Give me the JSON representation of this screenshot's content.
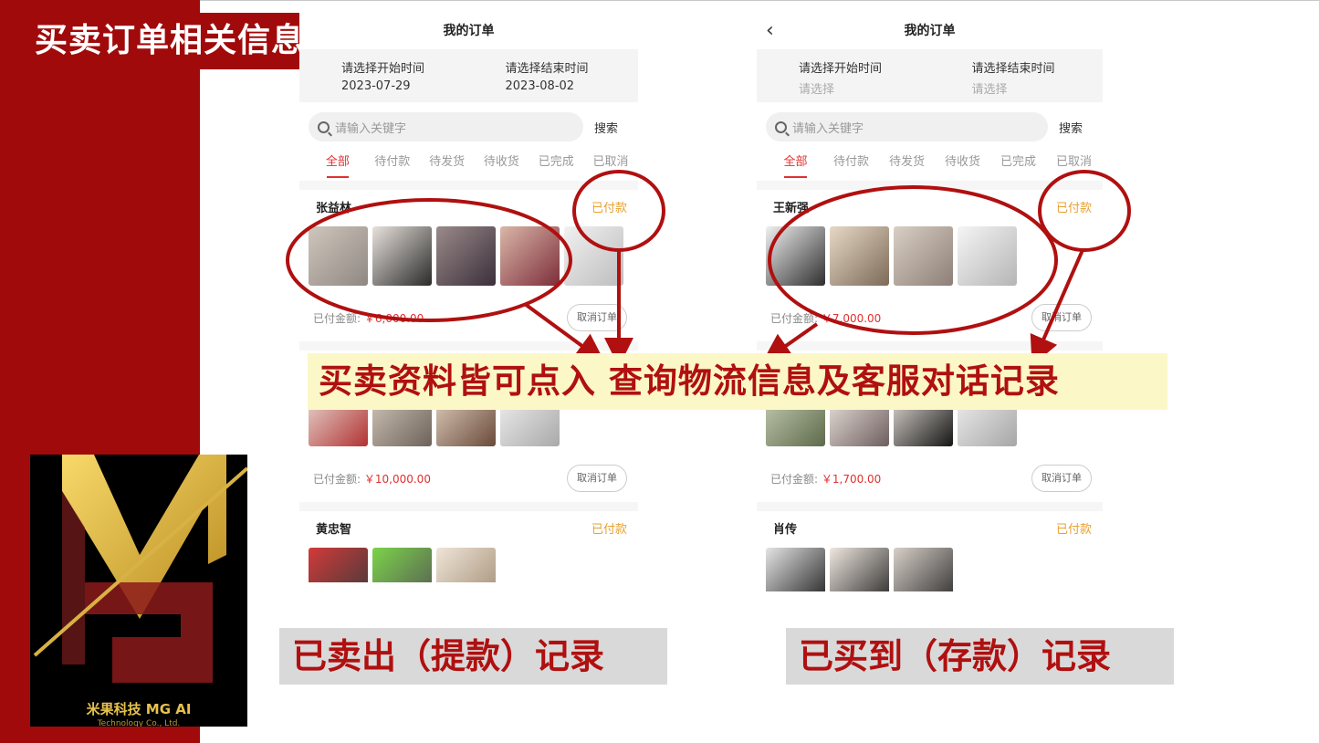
{
  "slide_title": "买卖订单相关信息",
  "logo": {
    "text_cn": "米果科技  MG AI",
    "text_en": "Technology Co., Ltd."
  },
  "colors": {
    "brand_red": "#a10a0a",
    "accent_red": "#e03030",
    "status_orange": "#e8a030",
    "highlight_bg": "#fbf7c6",
    "annotation_red": "#b01010",
    "logo_gold": "#e6c14d"
  },
  "left_phone": {
    "nav_title": "我的订单",
    "start_label": "请选择开始时间",
    "start_value": "2023-07-29",
    "end_label": "请选择结束时间",
    "end_value": "2023-08-02",
    "search_placeholder": "请输入关键字",
    "search_button": "搜索",
    "tabs": [
      "全部",
      "待付款",
      "待发货",
      "待收货",
      "已完成",
      "已取消"
    ],
    "orders": [
      {
        "name": "张益林",
        "status": "已付款",
        "paid_label": "已付金额:",
        "amount": "￥6,000.00",
        "cancel": "取消订单"
      },
      {
        "name": "",
        "status": "",
        "paid_label": "已付金额:",
        "amount": "￥10,000.00",
        "cancel": "取消订单"
      },
      {
        "name": "黄忠智",
        "status": "已付款"
      }
    ]
  },
  "right_phone": {
    "nav_title": "我的订单",
    "back_icon": "chevron-left-icon",
    "start_label": "请选择开始时间",
    "start_value": "请选择",
    "end_label": "请选择结束时间",
    "end_value": "请选择",
    "search_placeholder": "请输入关键字",
    "search_button": "搜索",
    "tabs": [
      "全部",
      "待付款",
      "待发货",
      "待收货",
      "已完成",
      "已取消"
    ],
    "orders": [
      {
        "name": "王新强",
        "status": "已付款",
        "paid_label": "已付金额:",
        "amount": "￥7,000.00",
        "cancel": "取消订单"
      },
      {
        "name": "",
        "status": "",
        "paid_label": "已付金额:",
        "amount": "￥1,700.00",
        "cancel": "取消订单"
      },
      {
        "name": "肖传",
        "status": "已付款"
      }
    ]
  },
  "annotations": {
    "highlight_text": "买卖资料皆可点入  查询物流信息及客服对话记录",
    "left_caption": "已卖出（提款）记录",
    "right_caption": "已买到（存款）记录"
  }
}
